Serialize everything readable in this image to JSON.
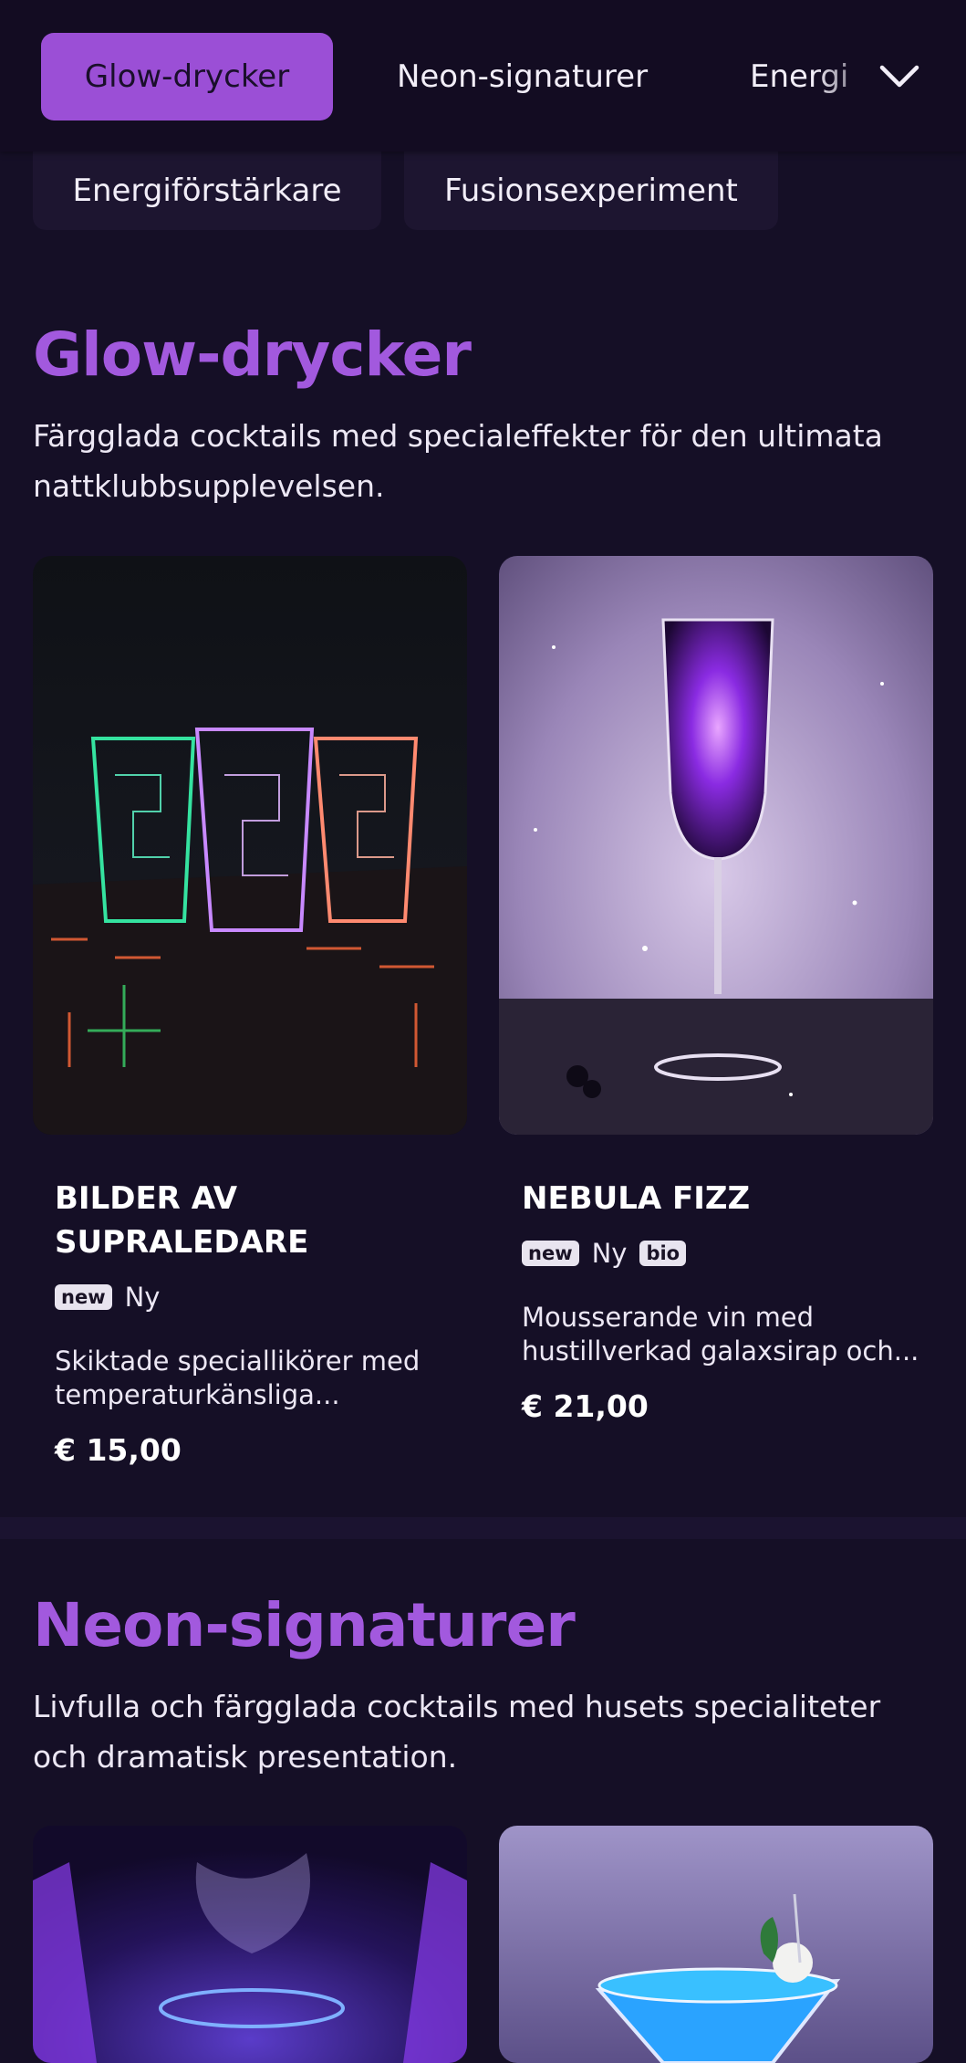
{
  "nav": {
    "tabs": [
      {
        "label": "Glow-drycker"
      },
      {
        "label": "Neon-signaturer"
      },
      {
        "label": "Energi"
      }
    ],
    "chips": [
      {
        "label": "Energiförstärkare"
      },
      {
        "label": "Fusionsexperiment"
      }
    ],
    "expand_icon": "chevron-down-icon"
  },
  "sections": [
    {
      "title": "Glow-drycker",
      "description": "Färgglada cocktails med specialeffekter för den ultimata nattklubbsupplevelsen.",
      "items": [
        {
          "name": "BILDER AV SUPRALEDARE",
          "badge": "new",
          "badge_text": "Ny",
          "description": "Skiktade speciallikörer med temperaturkänsliga...",
          "price": "€ 15,00"
        },
        {
          "name": "NEBULA FIZZ",
          "badge": "new",
          "badge_text": "Ny",
          "badge2": "bio",
          "description": "Mousserande vin med hustillverkad galaxsirap och...",
          "price": "€ 21,00"
        }
      ]
    },
    {
      "title": "Neon-signaturer",
      "description": "Livfulla och färgglada cocktails med husets specialiteter och dramatisk presentation."
    }
  ],
  "colors": {
    "background": "#150f26",
    "accent": "#a259de",
    "active_tab": "#9b4fd6"
  }
}
